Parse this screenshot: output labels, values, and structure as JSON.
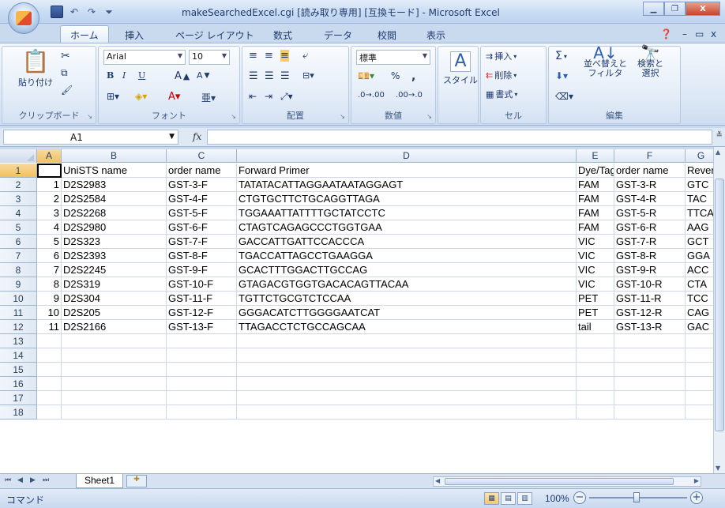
{
  "window": {
    "title": "makeSearchedExcel.cgi [読み取り専用] [互換モード] - Microsoft Excel",
    "minimize": "▁",
    "restore": "❐",
    "close": "X"
  },
  "ribbon": {
    "tabs": [
      "ホーム",
      "挿入",
      "ページ レイアウト",
      "数式",
      "データ",
      "校閲",
      "表示"
    ],
    "clipboard": {
      "paste": "貼り付け",
      "label": "クリップボード"
    },
    "font": {
      "name": "Arial",
      "size": "10",
      "label": "フォント",
      "bold": "B",
      "italic": "I",
      "underline": "U"
    },
    "alignment": {
      "label": "配置"
    },
    "number": {
      "format": "標準",
      "label": "数値",
      "percent": "%",
      "comma": ","
    },
    "styles": {
      "label": "スタイル"
    },
    "cells": {
      "insert": "挿入",
      "delete": "削除",
      "format": "書式",
      "label": "セル"
    },
    "editing": {
      "sigma": "Σ",
      "sort": "並べ替えと\nフィルタ",
      "find": "検索と\n選択",
      "label": "編集"
    }
  },
  "formula_bar": {
    "name_box": "A1",
    "fx": "fx",
    "value": ""
  },
  "columns": [
    "A",
    "B",
    "C",
    "D",
    "E",
    "F",
    "G"
  ],
  "column_header_G": "",
  "rows": [
    [
      "",
      "UniSTS name",
      "order name",
      "Forward Primer",
      "Dye/Tag",
      "order name",
      "Reverse Primer"
    ],
    [
      "1",
      "D2S2983",
      "GST-3-F",
      "TATATACATTAGGAATAATAGGAGT",
      "FAM",
      "GST-3-R",
      "GTC"
    ],
    [
      "2",
      "D2S2584",
      "GST-4-F",
      "CTGTGCTTCTGCAGGTTAGA",
      "FAM",
      "GST-4-R",
      "TAC"
    ],
    [
      "3",
      "D2S2268",
      "GST-5-F",
      "TGGAAATTATTTTGCTATCCTC",
      "FAM",
      "GST-5-R",
      "TTCA"
    ],
    [
      "4",
      "D2S2980",
      "GST-6-F",
      "CTAGTCAGAGCCCTGGTGAA",
      "FAM",
      "GST-6-R",
      "AAG"
    ],
    [
      "5",
      "D2S323",
      "GST-7-F",
      "GACCATTGATTCCACCCA",
      "VIC",
      "GST-7-R",
      "GCT"
    ],
    [
      "6",
      "D2S2393",
      "GST-8-F",
      "TGACCATTAGCCTGAAGGA",
      "VIC",
      "GST-8-R",
      "GGA"
    ],
    [
      "7",
      "D2S2245",
      "GST-9-F",
      "GCACTTTGGACTTGCCAG",
      "VIC",
      "GST-9-R",
      "ACC"
    ],
    [
      "8",
      "D2S319",
      "GST-10-F",
      "GTAGACGTGGTGACACAGTTACAA",
      "VIC",
      "GST-10-R",
      "CTA"
    ],
    [
      "9",
      "D2S304",
      "GST-11-F",
      "TGTTCTGCGTCTCCAA",
      "PET",
      "GST-11-R",
      "TCC"
    ],
    [
      "10",
      "D2S205",
      "GST-12-F",
      "GGGACATCTTGGGGAATCAT",
      "PET",
      "GST-12-R",
      "CAG"
    ],
    [
      "11",
      "D2S2166",
      "GST-13-F",
      "TTAGACCTCTGCCAGCAA",
      "tail",
      "GST-13-R",
      "GAC"
    ],
    [
      "",
      "",
      "",
      "",
      "",
      "",
      ""
    ],
    [
      "",
      "",
      "",
      "",
      "",
      "",
      ""
    ],
    [
      "",
      "",
      "",
      "",
      "",
      "",
      ""
    ],
    [
      "",
      "",
      "",
      "",
      "",
      "",
      ""
    ],
    [
      "",
      "",
      "",
      "",
      "",
      "",
      ""
    ],
    [
      "",
      "",
      "",
      "",
      "",
      "",
      ""
    ]
  ],
  "row_numbers": [
    "1",
    "2",
    "3",
    "4",
    "5",
    "6",
    "7",
    "8",
    "9",
    "10",
    "11",
    "12",
    "13",
    "14",
    "15",
    "16",
    "17",
    "18"
  ],
  "sheet_tabs": [
    "Sheet1"
  ],
  "status": {
    "mode": "コマンド",
    "zoom": "100%"
  }
}
